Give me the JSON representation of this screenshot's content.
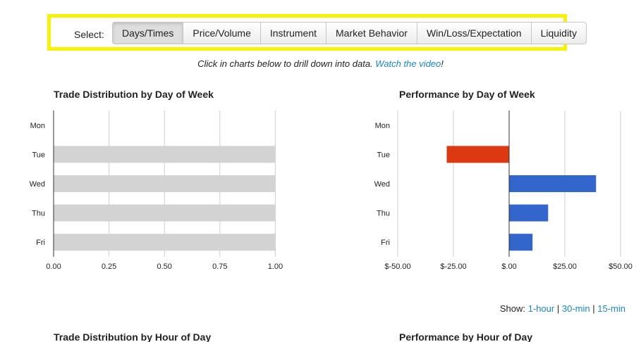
{
  "select_bar": {
    "label": "Select:",
    "buttons": [
      "Days/Times",
      "Price/Volume",
      "Instrument",
      "Market Behavior",
      "Win/Loss/Expectation",
      "Liquidity"
    ],
    "active_index": 0
  },
  "instructions": {
    "text": "Click in charts below to drill down into data.",
    "link": "Watch the video",
    "suffix": "!"
  },
  "show": {
    "label": "Show:",
    "links": [
      "1-hour",
      "30-min",
      "15-min"
    ],
    "separator": "|"
  },
  "colors": {
    "neutral_bar": "#d3d3d3",
    "positive_bar": "#3366cc",
    "negative_bar": "#dc3912",
    "gridline": "#cccccc",
    "link": "#1a87c9",
    "highlight_border": "#f7f200"
  },
  "chart_data": [
    {
      "type": "bar",
      "orientation": "horizontal",
      "title": "Trade Distribution by Day of Week",
      "categories": [
        "Mon",
        "Tue",
        "Wed",
        "Thu",
        "Fri"
      ],
      "values": [
        0,
        1.0,
        1.0,
        1.0,
        1.0
      ],
      "xlim": [
        0,
        1.25
      ],
      "ticks": [
        0,
        0.25,
        0.5,
        0.75,
        1.0
      ],
      "tick_labels": [
        "0.00",
        "0.25",
        "0.50",
        "0.75",
        "1.00"
      ],
      "grid": true
    },
    {
      "type": "bar",
      "orientation": "horizontal",
      "title": "Performance by Day of Week",
      "categories": [
        "Mon",
        "Tue",
        "Wed",
        "Thu",
        "Fri"
      ],
      "values": [
        0,
        -28,
        39,
        17.5,
        10.5
      ],
      "xlim": [
        -50,
        50
      ],
      "ticks": [
        -50,
        -25,
        0,
        25,
        50
      ],
      "tick_labels": [
        "$-50.00",
        "$-25.00",
        "$.00",
        "$25.00",
        "$50.00"
      ],
      "grid": true
    },
    {
      "type": "bar",
      "title": "Trade Distribution by Hour of Day"
    },
    {
      "type": "bar",
      "title": "Performance by Hour of Day"
    }
  ]
}
